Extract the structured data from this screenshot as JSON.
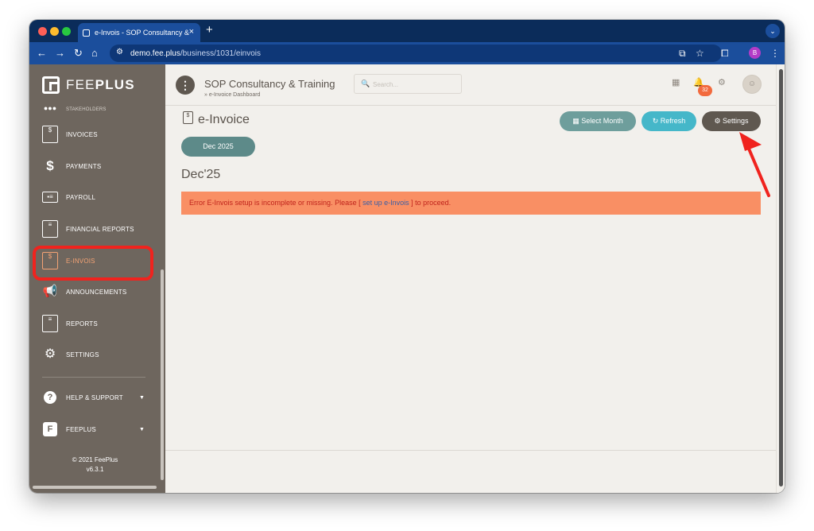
{
  "browser": {
    "tab_title": "e-Invois - SOP Consultancy &",
    "tab_close": "×",
    "new_tab": "+",
    "url_host": "demo.fee.plus",
    "url_path": "/business/1031/einvois",
    "profile_initial": "B"
  },
  "sidebar": {
    "logo_light": "FEE",
    "logo_bold": "PLUS",
    "partial_item": "STAKEHOLDERS",
    "items": [
      {
        "label": "INVOICES",
        "icon": "invoice-doc-icon"
      },
      {
        "label": "PAYMENTS",
        "icon": "dollar-icon"
      },
      {
        "label": "PAYROLL",
        "icon": "id-card-icon"
      },
      {
        "label": "FINANCIAL REPORTS",
        "icon": "report-doc-icon"
      },
      {
        "label": "E-INVOIS",
        "icon": "invoice-doc-icon",
        "active": true
      },
      {
        "label": "ANNOUNCEMENTS",
        "icon": "megaphone-icon"
      },
      {
        "label": "REPORTS",
        "icon": "document-icon"
      },
      {
        "label": "SETTINGS",
        "icon": "gears-icon"
      },
      {
        "label": "HELP & SUPPORT",
        "icon": "question-icon"
      },
      {
        "label": "FEEPLUS",
        "icon": "feeplus-icon"
      }
    ],
    "copyright": "© 2021 FeePlus",
    "version": "v6.3.1"
  },
  "topbar": {
    "business_name": "SOP Consultancy & Training",
    "breadcrumb": "» e-Invoice Dashboard",
    "search_placeholder": "Search...",
    "notification_count": "32"
  },
  "main": {
    "page_title": "e-Invoice",
    "buttons": {
      "select_month": "Select Month",
      "refresh": "Refresh",
      "settings": "Settings"
    },
    "period_label": "Dec 2025",
    "month_heading": "Dec'25",
    "alert": {
      "prefix": "Error E-Invois setup is incomplete or missing. Please [ ",
      "link": "set up e-Invois",
      "suffix": " ] to proceed."
    }
  },
  "colors": {
    "sidebar_bg": "#6e665e",
    "active_accent": "#f3a274",
    "select_month_btn": "#6e9e9c",
    "refresh_btn": "#45b7c9",
    "settings_btn": "#5f5850",
    "alert_bg": "#f98f64",
    "annotation_red": "#f0231e"
  }
}
